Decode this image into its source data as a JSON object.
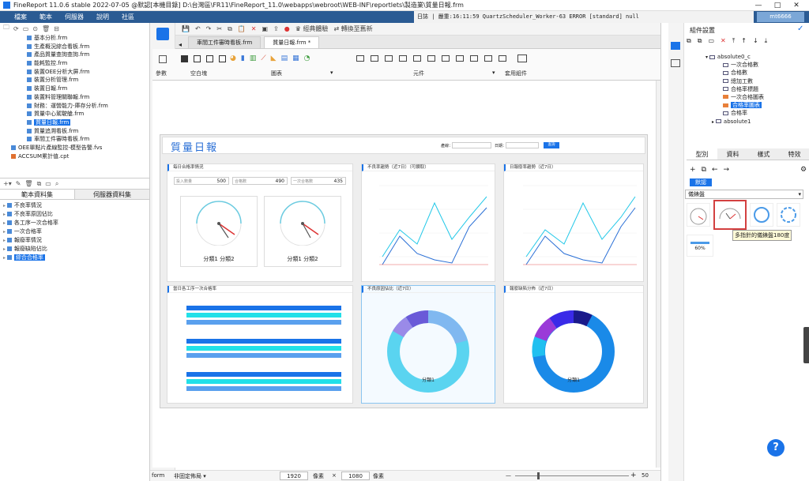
{
  "titlebar": {
    "title": "FineReport 11.0.6 stable 2022-07-05 @默認[本機目錄]    D:\\台灣區\\FR11\\FineReport_11.0\\webapps\\webroot\\WEB-INF\\reportlets\\製造業\\質量日報.frm",
    "minimize": "—",
    "maximize": "□",
    "close": "✕"
  },
  "menubar": {
    "items": [
      "檔案",
      "範本",
      "伺服器",
      "說明",
      "社區"
    ],
    "log_label": "日誌",
    "log_text": "| 嚴重:16:11:59 QuartzScheduler_Worker-63 ERROR [standard] null",
    "user": "mt6666"
  },
  "left": {
    "templates": [
      {
        "label": "基本分析.frm",
        "kind": "file"
      },
      {
        "label": "生產概況綜合看板.frm",
        "kind": "file"
      },
      {
        "label": "產品質量查詢查詢.frm",
        "kind": "file"
      },
      {
        "label": "能耗監控.frm",
        "kind": "file"
      },
      {
        "label": "裝置OEE分析大屏.frm",
        "kind": "file"
      },
      {
        "label": "裝置分析管理.frm",
        "kind": "file"
      },
      {
        "label": "裝置日報.frm",
        "kind": "file"
      },
      {
        "label": "裝置料管理關聯報.frm",
        "kind": "file"
      },
      {
        "label": "財務：運營能力-庫存分析.frm",
        "kind": "file"
      },
      {
        "label": "質量中心駕駛艙.frm",
        "kind": "file"
      },
      {
        "label": "質量日報.frm",
        "kind": "selected"
      },
      {
        "label": "質量追溯看板.frm",
        "kind": "file"
      },
      {
        "label": "車間工件審時看板.frm",
        "kind": "file"
      },
      {
        "label": "OEE單點片產線監控-模型告警.fvs",
        "kind": "root"
      },
      {
        "label": "ACCSUM累計值.cpt",
        "kind": "root"
      }
    ],
    "tab_template_data": "範本資料集",
    "tab_server_data": "伺服器資料集",
    "datasets": [
      "不良率情況",
      "不良率原因佔比",
      "各工序一次合格率",
      "一次合格率",
      "報廢率情況",
      "報廢缺陷佔比",
      "綜合合格率"
    ]
  },
  "doctabs": [
    {
      "label": "車間工件審時看板.frm",
      "active": false
    },
    {
      "label": "質量日報.frm *",
      "active": true
    }
  ],
  "toolbar": {
    "experience": "經典體驗",
    "switch_new": "轉換至舊新"
  },
  "ribbon": {
    "params": "參數",
    "blank": "空白塊",
    "chart": "圖表",
    "widget": "元件",
    "apply": "套用組件"
  },
  "report": {
    "title": "質量日報",
    "filter_a": "產線：",
    "filter_b": "日期：",
    "query_button": "查詢",
    "cards": {
      "pass_rate": {
        "title": "每日合格率情況",
        "stats": [
          {
            "label": "投入數量",
            "value": "500"
          },
          {
            "label": "合格數",
            "value": "490"
          },
          {
            "label": "一次合格數",
            "value": "435"
          }
        ],
        "gauges": [
          "分類1  分類2",
          "分類1  分類2"
        ]
      },
      "defect_trend": {
        "title": "不良率趨勢（近7日）（可鑽取）"
      },
      "scrap_trend": {
        "title": "日報廢率趨勢（近7日）"
      },
      "process_pass": {
        "title": "當日各工序一次合格率"
      },
      "defect_reason": {
        "title": "不良原因佔比（近7日）",
        "center": "分類1"
      },
      "scrap_defect": {
        "title": "報廢缺陷分佈（近7日）",
        "center": "分類1"
      }
    }
  },
  "statusbar": {
    "mode": "form",
    "layout": "非固定佈局",
    "width": "1920",
    "width_unit": "像素",
    "times": "×",
    "height": "1080",
    "height_unit": "像素",
    "zoom": "50"
  },
  "right": {
    "title": "組件設置",
    "tree": [
      {
        "label": "absolute0_c",
        "level": 0
      },
      {
        "label": "一次合格數",
        "level": 1
      },
      {
        "label": "合格數",
        "level": 1
      },
      {
        "label": "總加工數",
        "level": 1
      },
      {
        "label": "合格率標題",
        "level": 1
      },
      {
        "label": "一次合格圖表",
        "level": 1
      },
      {
        "label": "合格率圖表",
        "level": 1
      },
      {
        "label": "合格率",
        "level": 1
      },
      {
        "label": "absolute1",
        "level": 0
      }
    ],
    "tabs": [
      "型別",
      "資料",
      "樣式",
      "特效"
    ],
    "tag": "默認",
    "chart_type_select": "儀錶盤",
    "tooltip": "多指針的儀錶盤180度",
    "gauge_labels": [
      "60%",
      "60%",
      "60%"
    ]
  },
  "colors": {
    "menubar": "#2b5b93",
    "accent": "#1a73e8",
    "cyan": "#22c8e8",
    "cardtitle": "#1a73e8"
  }
}
